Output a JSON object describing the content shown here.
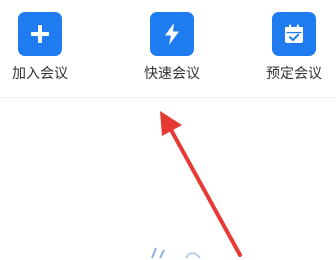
{
  "actions": [
    {
      "label": "加入会议",
      "icon": "plus-icon"
    },
    {
      "label": "快速会议",
      "icon": "lightning-icon"
    },
    {
      "label": "预定会议",
      "icon": "calendar-check-icon"
    }
  ],
  "colors": {
    "tile": "#1f7cf0",
    "label": "#333333",
    "annotation_arrow": "#e53b34"
  }
}
